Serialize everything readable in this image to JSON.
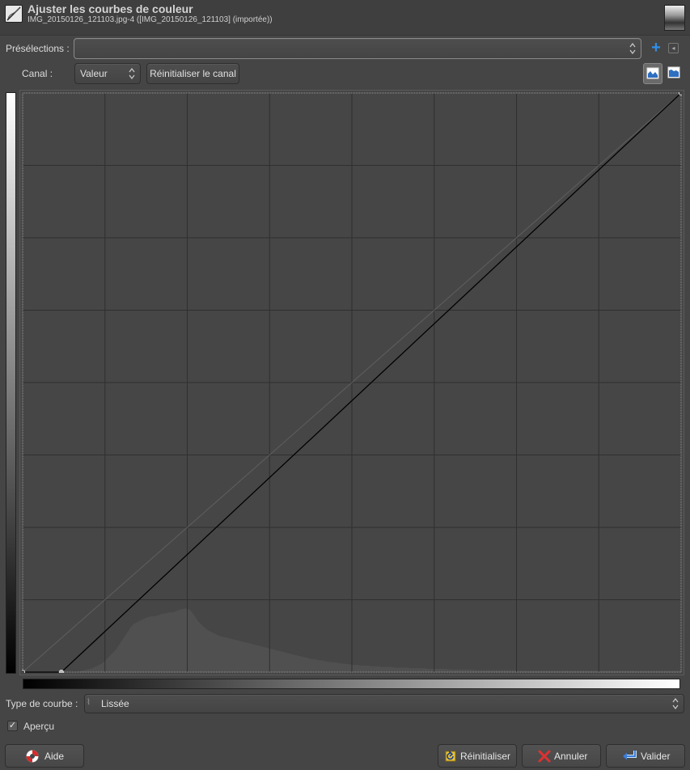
{
  "header": {
    "title": "Ajuster les courbes de couleur",
    "subtitle": "IMG_20150126_121103.jpg-4 ([IMG_20150126_121103] (importée))"
  },
  "presets": {
    "label": "Présélections :",
    "value": ""
  },
  "channel": {
    "label": "Canal :",
    "value": "Valeur",
    "reset_label": "Réinitialiser le canal"
  },
  "curve_type": {
    "label": "Type de courbe :",
    "value": "Lissée"
  },
  "preview": {
    "label": "Aperçu",
    "checked": true
  },
  "buttons": {
    "help": "Aide",
    "reset": "Réinitialiser",
    "cancel": "Annuler",
    "ok": "Valider"
  },
  "colors": {
    "background": "#454545",
    "grid": "#2f2f2f",
    "curve": "#000000",
    "histogram": "#505050",
    "accent": "#2f8fe8"
  },
  "curve": {
    "points": [
      [
        0,
        0
      ],
      [
        15,
        0
      ],
      [
        255,
        255
      ]
    ],
    "grid_divisions": 8
  },
  "histogram": [
    0,
    0,
    0,
    0,
    0,
    0,
    0,
    0,
    0,
    0,
    0,
    0,
    0,
    0,
    0,
    0,
    0,
    0,
    0,
    0,
    0,
    0,
    1,
    2,
    3,
    4,
    5,
    6,
    8,
    10,
    12,
    14,
    18,
    22,
    26,
    30,
    34,
    40,
    46,
    52,
    58,
    64,
    70,
    74,
    76,
    78,
    80,
    82,
    84,
    85,
    86,
    86,
    87,
    88,
    90,
    90,
    91,
    92,
    92,
    93,
    95,
    96,
    97,
    98,
    97,
    95,
    90,
    84,
    78,
    74,
    70,
    67,
    64,
    62,
    60,
    58,
    56,
    55,
    54,
    53,
    52,
    51,
    50,
    49,
    48,
    47,
    46,
    45,
    44,
    43,
    42,
    41,
    40,
    39,
    38,
    37,
    36,
    35,
    34,
    33,
    32,
    31,
    30,
    29,
    28,
    27,
    26,
    25,
    24,
    23,
    22,
    21,
    20,
    20,
    19,
    18,
    18,
    17,
    16,
    16,
    15,
    15,
    14,
    14,
    13,
    13,
    12,
    12,
    11,
    11,
    11,
    10,
    10,
    10,
    10,
    9,
    9,
    9,
    9,
    8,
    8,
    8,
    8,
    8,
    7,
    7,
    7,
    7,
    7,
    7,
    6,
    6,
    6,
    6,
    6,
    6,
    6,
    5,
    5,
    5,
    5,
    5,
    5,
    5,
    5,
    4,
    4,
    4,
    4,
    4,
    4,
    4,
    4,
    4,
    4,
    3,
    3,
    3,
    3,
    3,
    3,
    3,
    3,
    3,
    3,
    3,
    3,
    3,
    3,
    3,
    3,
    3,
    2,
    2,
    2,
    2,
    2,
    2,
    2,
    2,
    2,
    2,
    2,
    2,
    2,
    2,
    2,
    2,
    2,
    2,
    2,
    2,
    2,
    2,
    2,
    2,
    2,
    2,
    2,
    2,
    2,
    2,
    2,
    2,
    2,
    2,
    2,
    2,
    2,
    2,
    2,
    2,
    2,
    2,
    2,
    2,
    2,
    2,
    2,
    2,
    2,
    2,
    2,
    2,
    2,
    2,
    2,
    2,
    2,
    2,
    2,
    2,
    2,
    2,
    2,
    2,
    2,
    2,
    2,
    2,
    2,
    2,
    3,
    3,
    4,
    5,
    8
  ]
}
